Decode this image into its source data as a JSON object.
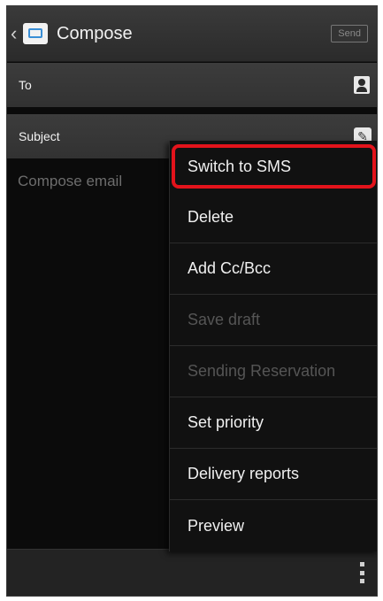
{
  "action_bar": {
    "back_glyph": "‹",
    "app_icon": "email-icon",
    "title": "Compose",
    "send_label": "Send"
  },
  "fields": {
    "to_label": "To",
    "to_icon": "contact-icon",
    "subject_label": "Subject",
    "subject_icon": "attachment-icon"
  },
  "body": {
    "placeholder": "Compose email"
  },
  "menu": {
    "items": [
      {
        "label": "Switch to SMS",
        "enabled": true,
        "highlighted": true
      },
      {
        "label": "Delete",
        "enabled": true
      },
      {
        "label": "Add Cc/Bcc",
        "enabled": true
      },
      {
        "label": "Save draft",
        "enabled": false
      },
      {
        "label": "Sending Reservation",
        "enabled": false
      },
      {
        "label": "Set priority",
        "enabled": true
      },
      {
        "label": "Delivery reports",
        "enabled": true
      },
      {
        "label": "Preview",
        "enabled": true
      }
    ]
  },
  "bottom_bar": {
    "overflow_icon": "more-vertical-icon"
  },
  "colors": {
    "highlight": "#e3131b",
    "background": "#0b0b0b",
    "field_bg": "#383838"
  }
}
